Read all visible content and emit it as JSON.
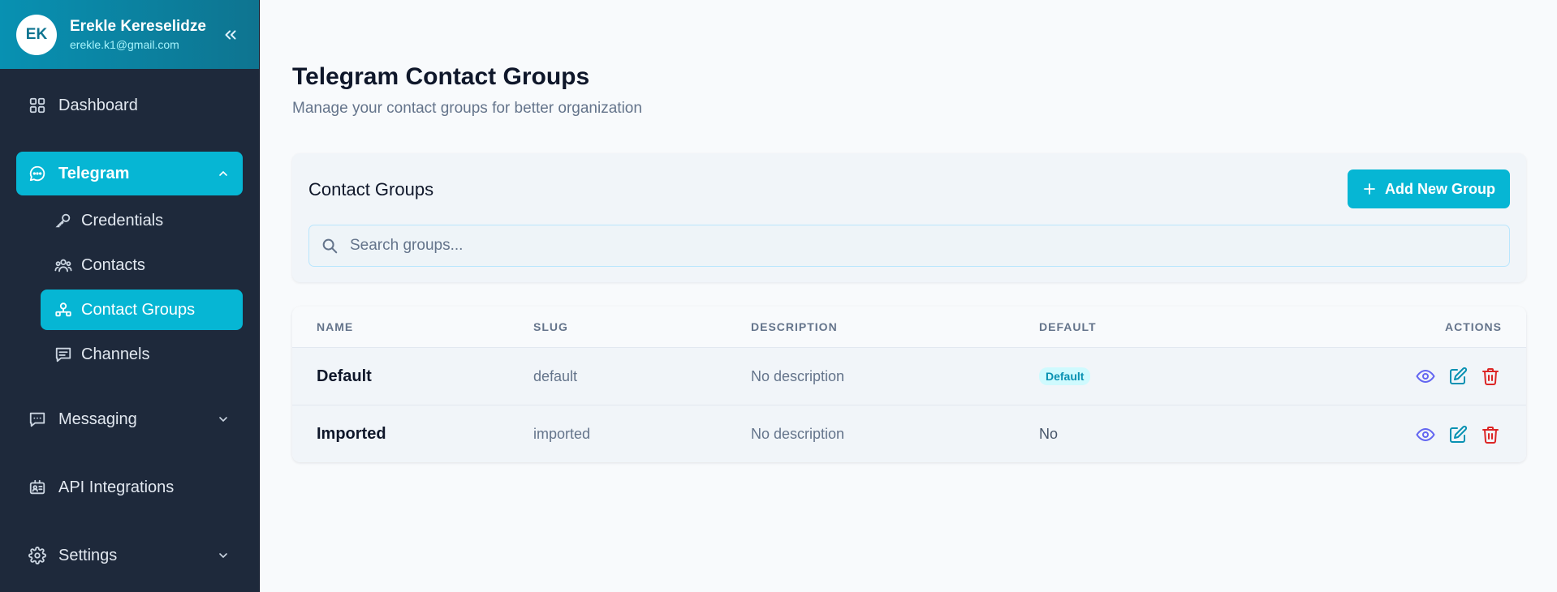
{
  "user": {
    "initials": "EK",
    "name": "Erekle Kereselidze",
    "email": "erekle.k1@gmail.com"
  },
  "sidebar": {
    "items": [
      {
        "label": "Dashboard",
        "icon": "grid-icon"
      },
      {
        "label": "Telegram",
        "icon": "chat-bubble-icon",
        "expanded": true
      },
      {
        "label": "Messaging",
        "icon": "message-square-icon"
      },
      {
        "label": "API Integrations",
        "icon": "id-card-icon"
      },
      {
        "label": "Settings",
        "icon": "gear-icon"
      }
    ],
    "telegram_sub": [
      {
        "label": "Credentials",
        "icon": "key-icon"
      },
      {
        "label": "Contacts",
        "icon": "users-icon"
      },
      {
        "label": "Contact Groups",
        "icon": "user-group-icon",
        "active": true
      },
      {
        "label": "Channels",
        "icon": "message-square-icon"
      }
    ]
  },
  "page": {
    "title": "Telegram Contact Groups",
    "subtitle": "Manage your contact groups for better organization"
  },
  "groups_card": {
    "title": "Contact Groups",
    "add_button": "Add New Group",
    "search_placeholder": "Search groups..."
  },
  "table": {
    "headers": [
      "NAME",
      "SLUG",
      "DESCRIPTION",
      "DEFAULT",
      "ACTIONS"
    ],
    "rows": [
      {
        "name": "Default",
        "slug": "default",
        "description": "No description",
        "default": "Default",
        "is_default": true
      },
      {
        "name": "Imported",
        "slug": "imported",
        "description": "No description",
        "default": "No",
        "is_default": false
      }
    ]
  },
  "colors": {
    "accent": "#06b6d4",
    "sidebar_bg": "#1e293b",
    "view_icon": "#6366f1",
    "edit_icon": "#0891b2",
    "delete_icon": "#dc2626"
  }
}
